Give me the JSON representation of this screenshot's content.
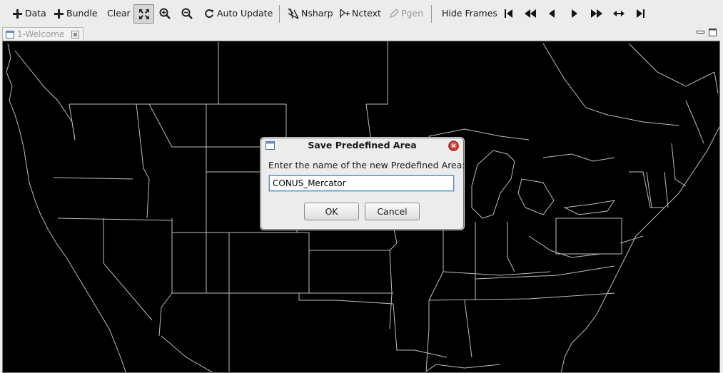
{
  "toolbar": {
    "data_label": "Data",
    "bundle_label": "Bundle",
    "clear_label": "Clear",
    "auto_update_label": "Auto Update",
    "nsharp_label": "Nsharp",
    "nctext_label": "Nctext",
    "pgen_label": "Pgen",
    "hide_frames_label": "Hide Frames"
  },
  "tab": {
    "label": "1-Welcome"
  },
  "dialog": {
    "title": "Save Predefined Area",
    "prompt": "Enter the name of the new Predefined Area:",
    "input_value": "CONUS_Mercator",
    "ok_label": "OK",
    "cancel_label": "Cancel"
  },
  "colors": {
    "map_background": "#000000",
    "map_lines": "#bdbdbd",
    "close_button": "#d9342b",
    "input_focus": "#4f8fc9"
  }
}
